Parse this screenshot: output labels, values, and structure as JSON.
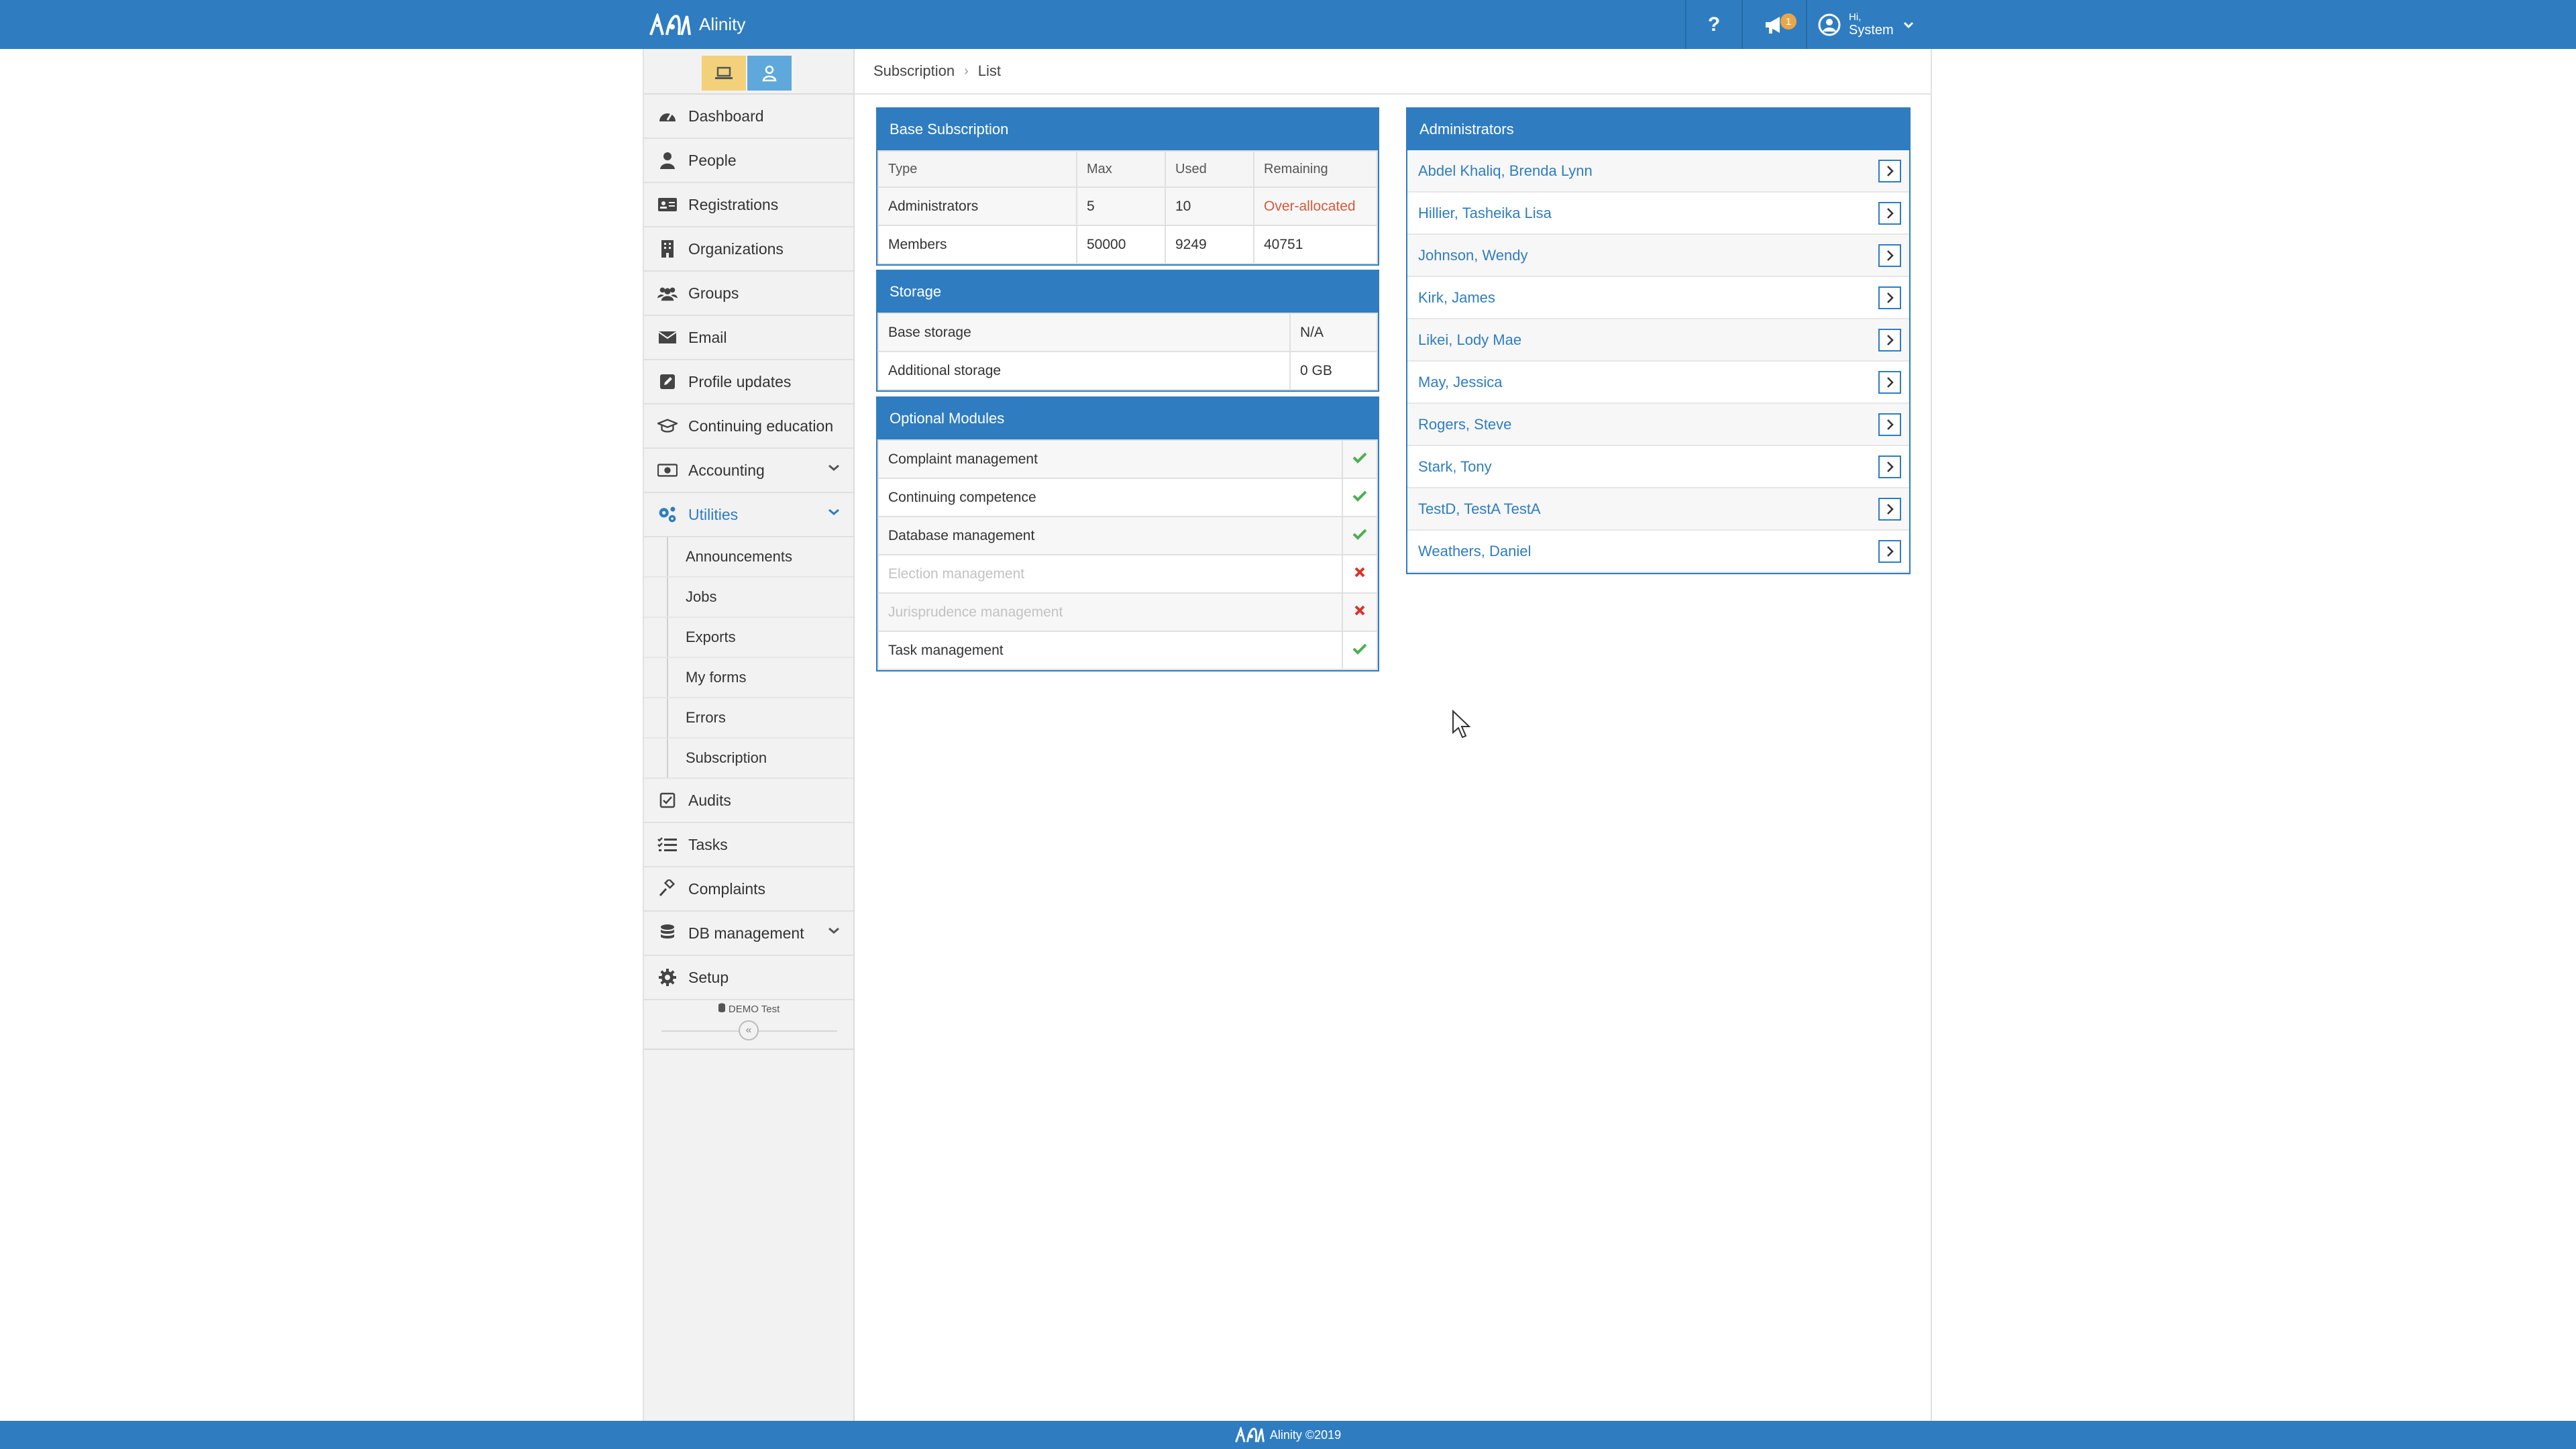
{
  "app": {
    "name": "Alinity"
  },
  "topbar": {
    "help_label": "?",
    "notifications_count": "1",
    "user_greeting": "Hi,",
    "user_name": "System"
  },
  "breadcrumb": {
    "items": [
      "Subscription",
      "List"
    ]
  },
  "sidebar": {
    "items": [
      {
        "label": "Dashboard",
        "icon": "dashboard-icon"
      },
      {
        "label": "People",
        "icon": "person-icon"
      },
      {
        "label": "Registrations",
        "icon": "id-card-icon"
      },
      {
        "label": "Organizations",
        "icon": "building-icon"
      },
      {
        "label": "Groups",
        "icon": "users-icon"
      },
      {
        "label": "Email",
        "icon": "envelope-icon"
      },
      {
        "label": "Profile updates",
        "icon": "edit-icon"
      },
      {
        "label": "Continuing education",
        "icon": "graduation-cap-icon"
      },
      {
        "label": "Accounting",
        "icon": "money-icon"
      },
      {
        "label": "Utilities",
        "icon": "cogs-icon"
      }
    ],
    "utilities_subitems": [
      "Announcements",
      "Jobs",
      "Exports",
      "My forms",
      "Errors",
      "Subscription"
    ],
    "bottom_items": [
      {
        "label": "Audits",
        "icon": "check-square-icon"
      },
      {
        "label": "Tasks",
        "icon": "tasks-icon"
      },
      {
        "label": "Complaints",
        "icon": "gavel-icon"
      },
      {
        "label": "DB management",
        "icon": "database-icon"
      },
      {
        "label": "Setup",
        "icon": "gear-icon"
      }
    ],
    "environment_label": "DEMO Test",
    "collapse_label": "«"
  },
  "base_subscription": {
    "title": "Base Subscription",
    "columns": [
      "Type",
      "Max",
      "Used",
      "Remaining"
    ],
    "rows": [
      [
        "Administrators",
        "5",
        "10",
        "Over-allocated"
      ],
      [
        "Members",
        "50000",
        "9249",
        "40751"
      ]
    ]
  },
  "storage": {
    "title": "Storage",
    "rows": [
      [
        "Base storage",
        "N/A"
      ],
      [
        "Additional storage",
        "0 GB"
      ]
    ]
  },
  "optional_modules": {
    "title": "Optional Modules",
    "rows": [
      {
        "name": "Complaint management",
        "enabled": true
      },
      {
        "name": "Continuing competence",
        "enabled": true
      },
      {
        "name": "Database management",
        "enabled": true
      },
      {
        "name": "Election management",
        "enabled": false
      },
      {
        "name": "Jurisprudence management",
        "enabled": false
      },
      {
        "name": "Task management",
        "enabled": true
      }
    ]
  },
  "administrators": {
    "title": "Administrators",
    "names": [
      "Abdel Khaliq, Brenda Lynn",
      "Hillier, Tasheika Lisa",
      "Johnson, Wendy",
      "Kirk, James",
      "Likei, Lody Mae",
      "May, Jessica",
      "Rogers, Steve",
      "Stark, Tony",
      "TestD, TestA TestA",
      "Weathers, Daniel"
    ]
  },
  "footer": {
    "text": "Alinity ©2019"
  },
  "colors": {
    "primary": "#2f7dc0",
    "over_allocated": "#d45a3a",
    "check": "#4caf50",
    "cross": "#d9342b",
    "desktop_toggle": "#f2d17a",
    "person_toggle": "#5fa8dc"
  }
}
